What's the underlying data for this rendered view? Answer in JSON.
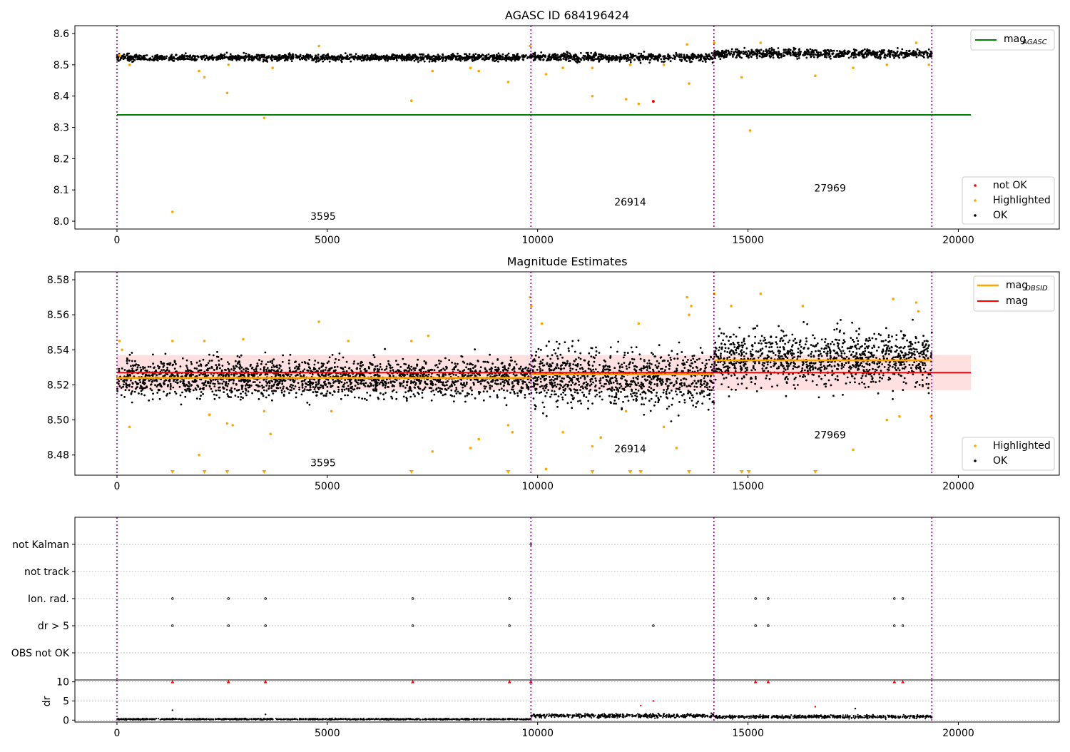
{
  "chart_data": [
    {
      "type": "scatter",
      "title": "AGASC ID 684196424",
      "xlim": [
        -1000,
        22400
      ],
      "ylim": [
        7.975,
        8.625
      ],
      "xticks": [
        0,
        5000,
        10000,
        15000,
        20000
      ],
      "yticks": [
        "8.0",
        "8.1",
        "8.2",
        "8.3",
        "8.4",
        "8.5",
        "8.6"
      ],
      "obs_boundaries": [
        0,
        9840,
        14190,
        19370
      ],
      "mag_agasc": 8.34,
      "mag_agasc_xrange": [
        0,
        20300
      ],
      "obs_labels": [
        {
          "x": 4900,
          "y": 8.005,
          "text": "3595"
        },
        {
          "x": 12200,
          "y": 8.05,
          "text": "26914"
        },
        {
          "x": 16950,
          "y": 8.095,
          "text": "27969"
        }
      ],
      "segments": [
        {
          "x0": 0,
          "x1": 9840,
          "mean": 8.523,
          "spread": 0.007
        },
        {
          "x0": 9840,
          "x1": 14190,
          "mean": 8.524,
          "spread": 0.009
        },
        {
          "x0": 14190,
          "x1": 19370,
          "mean": 8.536,
          "spread": 0.01
        }
      ],
      "highlighted": [
        [
          60,
          8.53
        ],
        [
          300,
          8.5
        ],
        [
          1320,
          8.03
        ],
        [
          1950,
          8.48
        ],
        [
          2080,
          8.46
        ],
        [
          2620,
          8.41
        ],
        [
          2650,
          8.5
        ],
        [
          3500,
          8.33
        ],
        [
          3700,
          8.49
        ],
        [
          4800,
          8.56
        ],
        [
          7000,
          8.385
        ],
        [
          7500,
          8.48
        ],
        [
          8400,
          8.49
        ],
        [
          8600,
          8.48
        ],
        [
          9300,
          8.445
        ],
        [
          9820,
          8.56
        ],
        [
          10200,
          8.47
        ],
        [
          10600,
          8.49
        ],
        [
          11300,
          8.4
        ],
        [
          11300,
          8.49
        ],
        [
          12100,
          8.39
        ],
        [
          12400,
          8.375
        ],
        [
          12200,
          8.5
        ],
        [
          13000,
          8.5
        ],
        [
          13550,
          8.565
        ],
        [
          13600,
          8.44
        ],
        [
          14200,
          8.57
        ],
        [
          14850,
          8.46
        ],
        [
          15050,
          8.29
        ],
        [
          15300,
          8.57
        ],
        [
          16600,
          8.465
        ],
        [
          17500,
          8.49
        ],
        [
          18300,
          8.5
        ],
        [
          19300,
          8.5
        ],
        [
          19000,
          8.57
        ]
      ],
      "not_ok": [
        [
          12750,
          8.383
        ]
      ],
      "legend_lines": [
        {
          "label": "mag",
          "sub": "AGASC",
          "color": "#008000"
        }
      ],
      "legend_points": [
        {
          "label": "not OK",
          "color": "#ff0000"
        },
        {
          "label": "Highlighted",
          "color": "#ffa500"
        },
        {
          "label": "OK",
          "color": "#000000"
        }
      ]
    },
    {
      "type": "scatter",
      "title": "Magnitude Estimates",
      "xlim": [
        -1000,
        22400
      ],
      "ylim": [
        8.4685,
        8.5845
      ],
      "xticks": [
        0,
        5000,
        10000,
        15000,
        20000
      ],
      "yticks": [
        "8.48",
        "8.50",
        "8.52",
        "8.54",
        "8.56",
        "8.58"
      ],
      "obs_boundaries": [
        0,
        9840,
        14190,
        19370
      ],
      "mag": 8.527,
      "mag_band": [
        8.517,
        8.537
      ],
      "mag_xrange": [
        0,
        20300
      ],
      "mag_obsid": [
        {
          "x0": 0,
          "x1": 9840,
          "y": 8.524
        },
        {
          "x0": 9840,
          "x1": 14190,
          "y": 8.526
        },
        {
          "x0": 14190,
          "x1": 19370,
          "y": 8.534
        }
      ],
      "obs_labels": [
        {
          "x": 4900,
          "y": 8.4735,
          "text": "3595"
        },
        {
          "x": 12200,
          "y": 8.4815,
          "text": "26914"
        },
        {
          "x": 16950,
          "y": 8.4895,
          "text": "27969"
        }
      ],
      "segments": [
        {
          "x0": 0,
          "x1": 9840,
          "mean": 8.524,
          "spread": 0.0075
        },
        {
          "x0": 9840,
          "x1": 14190,
          "mean": 8.524,
          "spread": 0.011
        },
        {
          "x0": 14190,
          "x1": 19370,
          "mean": 8.535,
          "spread": 0.0105
        }
      ],
      "highlighted": [
        [
          60,
          8.545
        ],
        [
          120,
          8.54
        ],
        [
          300,
          8.496
        ],
        [
          1320,
          8.545
        ],
        [
          1950,
          8.48
        ],
        [
          2080,
          8.545
        ],
        [
          2200,
          8.503
        ],
        [
          2620,
          8.498
        ],
        [
          2750,
          8.497
        ],
        [
          3000,
          8.546
        ],
        [
          3650,
          8.492
        ],
        [
          3500,
          8.505
        ],
        [
          4800,
          8.556
        ],
        [
          5100,
          8.505
        ],
        [
          5500,
          8.545
        ],
        [
          7000,
          8.545
        ],
        [
          7400,
          8.548
        ],
        [
          7500,
          8.482
        ],
        [
          8400,
          8.484
        ],
        [
          8600,
          8.489
        ],
        [
          9300,
          8.497
        ],
        [
          9400,
          8.493
        ],
        [
          9820,
          8.57
        ],
        [
          9850,
          8.565
        ],
        [
          10100,
          8.555
        ],
        [
          10200,
          8.472
        ],
        [
          10600,
          8.493
        ],
        [
          11300,
          8.485
        ],
        [
          11500,
          8.49
        ],
        [
          12100,
          8.505
        ],
        [
          12400,
          8.555
        ],
        [
          13000,
          8.496
        ],
        [
          13300,
          8.484
        ],
        [
          13550,
          8.57
        ],
        [
          13600,
          8.56
        ],
        [
          13650,
          8.565
        ],
        [
          14200,
          8.572
        ],
        [
          14600,
          8.565
        ],
        [
          15300,
          8.572
        ],
        [
          16300,
          8.565
        ],
        [
          17500,
          8.483
        ],
        [
          18300,
          8.5
        ],
        [
          18450,
          8.569
        ],
        [
          18600,
          8.502
        ],
        [
          19000,
          8.567
        ],
        [
          19050,
          8.562
        ],
        [
          19350,
          8.502
        ]
      ],
      "below_axis_markers": [
        1320,
        2080,
        2620,
        3500,
        7000,
        9300,
        11300,
        12200,
        12450,
        13600,
        14850,
        15020,
        16600
      ],
      "legend_lines": [
        {
          "label": "mag",
          "sub": "OBSID",
          "color": "#ffa500"
        },
        {
          "label": "mag",
          "sub": "",
          "color": "#ff0000"
        }
      ],
      "legend_points": [
        {
          "label": "Highlighted",
          "color": "#ffa500"
        },
        {
          "label": "OK",
          "color": "#000000"
        }
      ]
    },
    {
      "type": "scatter",
      "title": "",
      "xlim": [
        -1000,
        22400
      ],
      "categories": [
        "not Kalman",
        "not track",
        "Ion. rad.",
        "dr > 5",
        "OBS not OK"
      ],
      "obs_boundaries": [
        0,
        9840,
        14190,
        19370
      ],
      "flags": {
        "not Kalman": [
          9840
        ],
        "not track": [],
        "Ion. rad.": [
          1320,
          2650,
          3530,
          7030,
          9330,
          15180,
          15480,
          18480,
          18680
        ],
        "dr > 5": [
          1320,
          2650,
          3530,
          7030,
          9330,
          12750,
          15180,
          15480,
          18480,
          18680
        ],
        "OBS not OK": []
      }
    },
    {
      "type": "scatter",
      "title": "",
      "ylabel": "dr",
      "xlim": [
        -1000,
        22400
      ],
      "ylim": [
        -0.5,
        10.5
      ],
      "xticks": [
        0,
        5000,
        10000,
        15000,
        20000
      ],
      "yticks": [
        "0",
        "5",
        "10"
      ],
      "obs_boundaries": [
        0,
        9840,
        14190,
        19370
      ],
      "segments": [
        {
          "x0": 0,
          "x1": 9840,
          "mean": 0.25,
          "spread": 0.12
        },
        {
          "x0": 9840,
          "x1": 14190,
          "mean": 1.15,
          "spread": 0.35
        },
        {
          "x0": 14190,
          "x1": 19370,
          "mean": 0.9,
          "spread": 0.3
        }
      ],
      "clipped_markers": [
        1320,
        2650,
        3530,
        7030,
        9330,
        9840,
        15180,
        15480,
        18480,
        18680
      ],
      "outliers": [
        [
          1320,
          2.6
        ],
        [
          3530,
          1.5
        ],
        [
          12450,
          3.8
        ],
        [
          12750,
          5.0
        ],
        [
          16600,
          3.5
        ],
        [
          17550,
          3.0
        ]
      ]
    }
  ]
}
